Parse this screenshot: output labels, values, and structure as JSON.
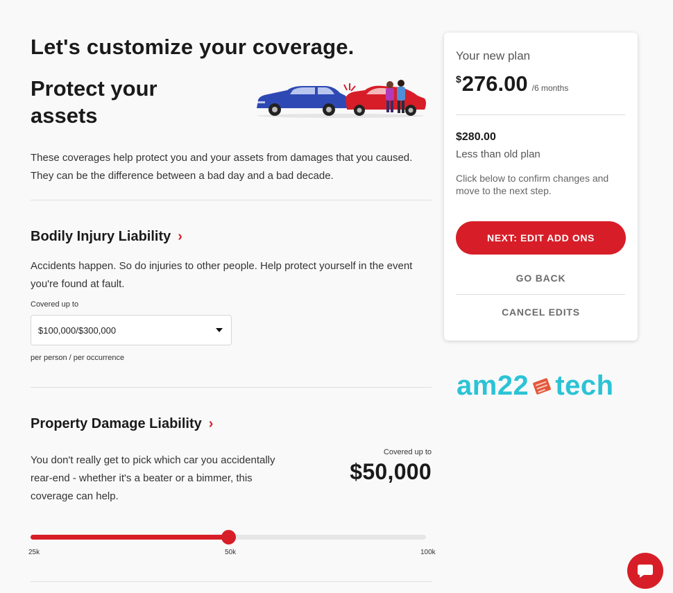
{
  "page": {
    "title": "Let's customize your coverage.",
    "section_title": "Protect your assets",
    "intro": "These coverages help protect you and your assets from damages that you caused. They can be the difference between a bad day and a bad decade."
  },
  "bodily_injury": {
    "title": "Bodily Injury Liability",
    "description": "Accidents happen. So do injuries to other people. Help protect yourself in the event you're found at fault.",
    "covered_label": "Covered up to",
    "selected_value": "$100,000/$300,000",
    "sublabel": "per person / per occurrence"
  },
  "property_damage": {
    "title": "Property Damage Liability",
    "description": "You don't really get to pick which car you accidentally rear-end - whether it's a beater or a bimmer, this coverage can help.",
    "covered_label": "Covered up to",
    "amount": "$50,000",
    "slider": {
      "min_label": "25k",
      "mid_label": "50k",
      "max_label": "100k",
      "value_fraction": 0.5
    }
  },
  "plan": {
    "label": "Your new plan",
    "currency": "$",
    "price": "276.00",
    "period": "/6 months",
    "difference": "$280.00",
    "difference_note": "Less than old plan",
    "help": "Click below to confirm changes and move to the next step.",
    "next_button": "NEXT: EDIT ADD ONS",
    "back_button": "GO BACK",
    "cancel_button": "CANCEL EDITS"
  },
  "watermark": {
    "text_left": "am22",
    "text_right": "tech"
  },
  "icons": {
    "chevron": "chevron-right-icon",
    "dropdown": "caret-down-icon",
    "chat": "chat-bubble-icon",
    "hero": "car-accident-illustration"
  },
  "colors": {
    "accent": "#d71e28",
    "watermark": "#2bc3d6",
    "background": "#f9f9f9"
  }
}
